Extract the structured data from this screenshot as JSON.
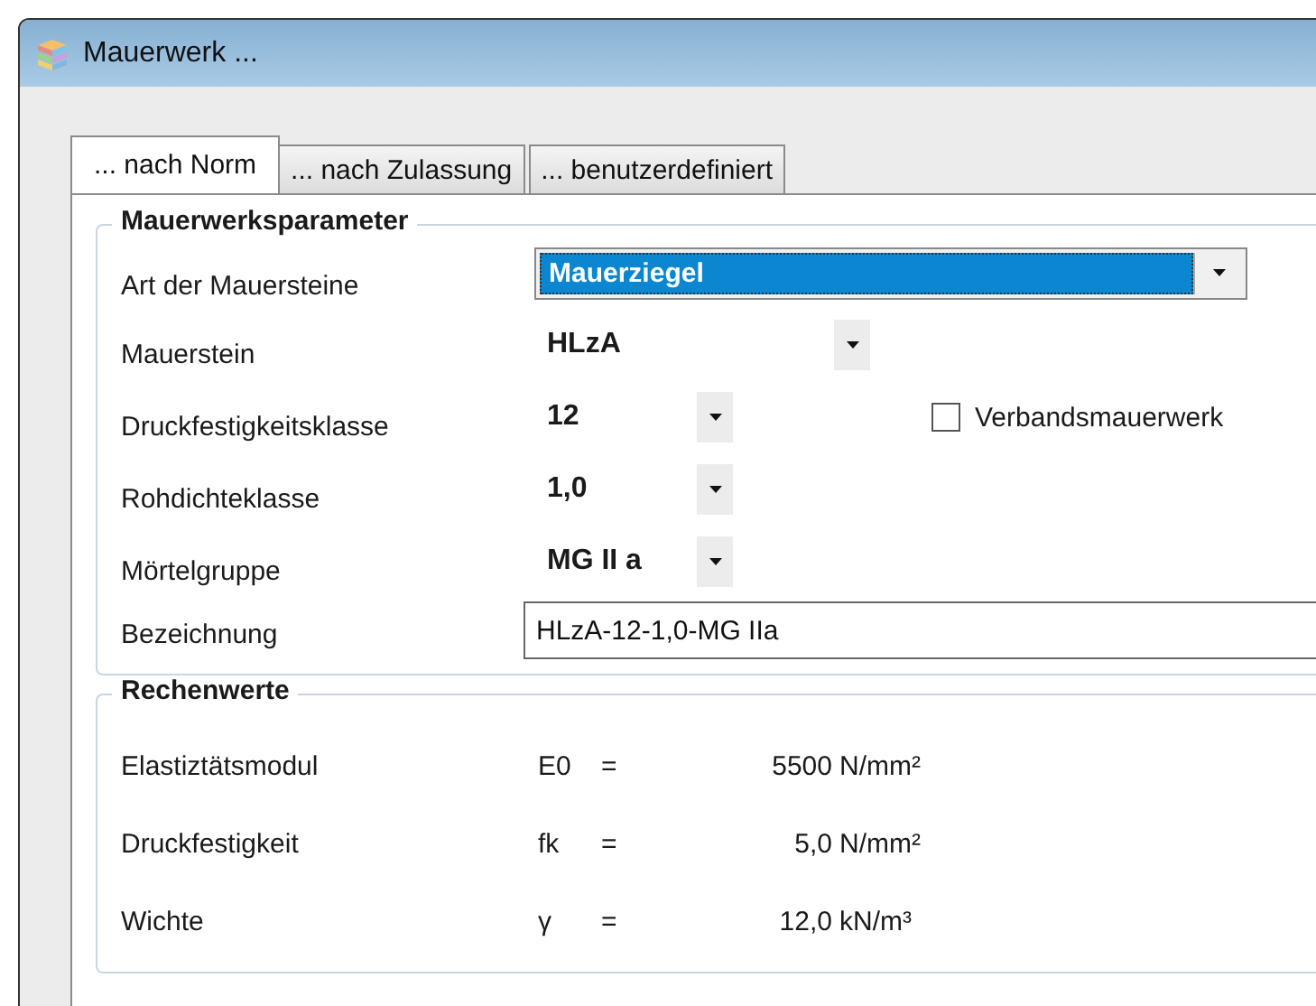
{
  "window": {
    "title": "Mauerwerk ..."
  },
  "tabs": [
    {
      "label": "... nach Norm",
      "selected": true
    },
    {
      "label": "... nach Zulassung",
      "selected": false
    },
    {
      "label": "... benutzerdefiniert",
      "selected": false
    }
  ],
  "parameters": {
    "title": "Mauerwerksparameter",
    "rows": [
      {
        "label": "Art der Mauersteine",
        "kind": "combo",
        "value": "Mauerziegel",
        "selected": true
      },
      {
        "label": "Mauerstein",
        "kind": "flat-wide",
        "value": "HLzA"
      },
      {
        "label": "Druckfestigkeitsklasse",
        "kind": "flat",
        "value": "12",
        "option": {
          "label": "Verbandsmauerwerk",
          "checked": false
        }
      },
      {
        "label": "Rohdichteklasse",
        "kind": "flat",
        "value": "1,0"
      },
      {
        "label": "Mörtelgruppe",
        "kind": "flat",
        "value": "MG II a"
      },
      {
        "label": "Bezeichnung",
        "kind": "text",
        "value": "HLzA-12-1,0-MG IIa"
      }
    ]
  },
  "results": {
    "title": "Rechenwerte",
    "rows": [
      {
        "label": "Elastiztätsmodul",
        "symbol": "E0",
        "equals": "=",
        "value": "5500",
        "unit": "N/mm²"
      },
      {
        "label": "Druckfestigkeit",
        "symbol": "fk",
        "equals": "=",
        "value": "5,0",
        "unit": "N/mm²"
      },
      {
        "label": "Wichte",
        "symbol": "γ",
        "equals": "=",
        "value": "12,0",
        "unit": "kN/m³"
      }
    ]
  }
}
